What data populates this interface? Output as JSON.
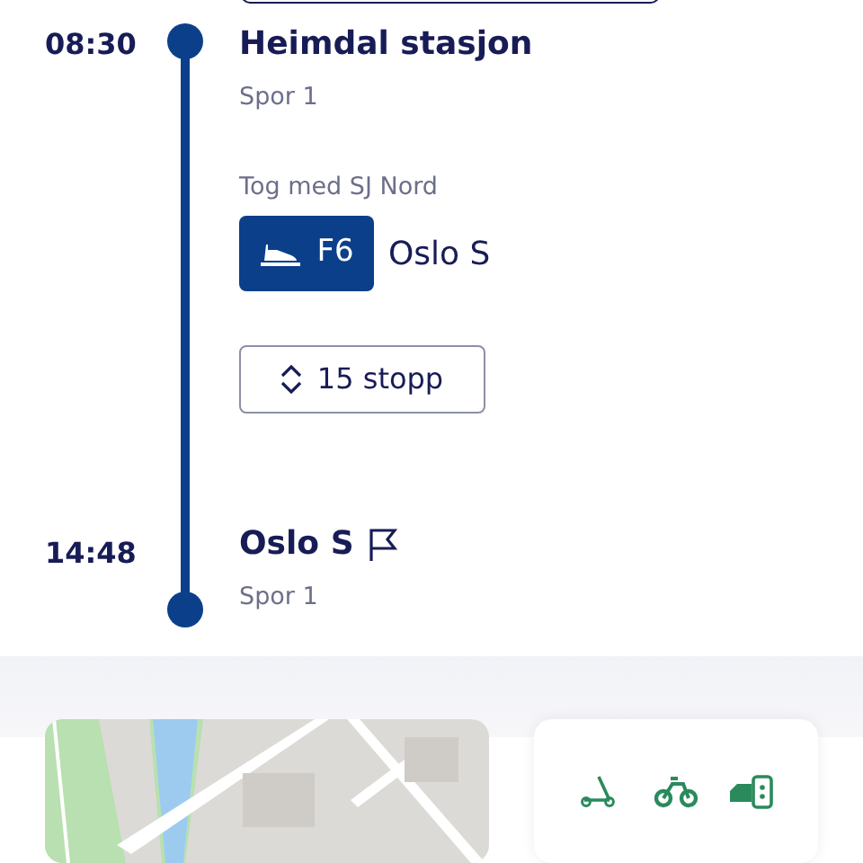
{
  "departure": {
    "time": "08:30",
    "station": "Heimdal stasjon",
    "track": "Spor 1"
  },
  "leg": {
    "operator": "Tog med SJ Nord",
    "line": "F6",
    "destination": "Oslo S",
    "stops_button": "15 stopp"
  },
  "arrival": {
    "time": "14:48",
    "station": "Oslo S",
    "track": "Spor 1"
  },
  "mobility": {
    "options": [
      {
        "kind": "scooter"
      },
      {
        "kind": "bike"
      },
      {
        "kind": "car"
      }
    ]
  }
}
